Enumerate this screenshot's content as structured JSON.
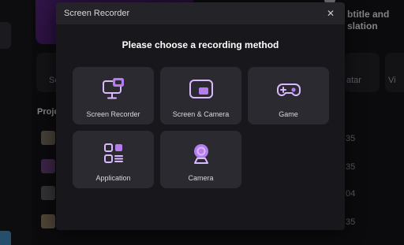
{
  "background": {
    "hero_right_title": "btitle and",
    "hero_right_subtitle": "slation",
    "cards": [
      "Sc",
      "atar",
      "Vi"
    ],
    "projects_label": "Proje",
    "row_dates": [
      "35",
      "35",
      "04",
      "35"
    ]
  },
  "dialog": {
    "title": "Screen Recorder",
    "close_glyph": "✕",
    "heading": "Please choose a recording method",
    "options": [
      {
        "label": "Screen Recorder",
        "icon": "screen-recorder-icon"
      },
      {
        "label": "Screen & Camera",
        "icon": "screen-camera-icon"
      },
      {
        "label": "Game",
        "icon": "gamepad-icon"
      },
      {
        "label": "Application",
        "icon": "application-grid-icon"
      },
      {
        "label": "Camera",
        "icon": "webcam-icon"
      }
    ]
  },
  "colors": {
    "accent": "#b57cf0",
    "accent_light": "#d9b8ff",
    "modal_bg": "#18181c",
    "tile_bg": "#2a2a30"
  }
}
